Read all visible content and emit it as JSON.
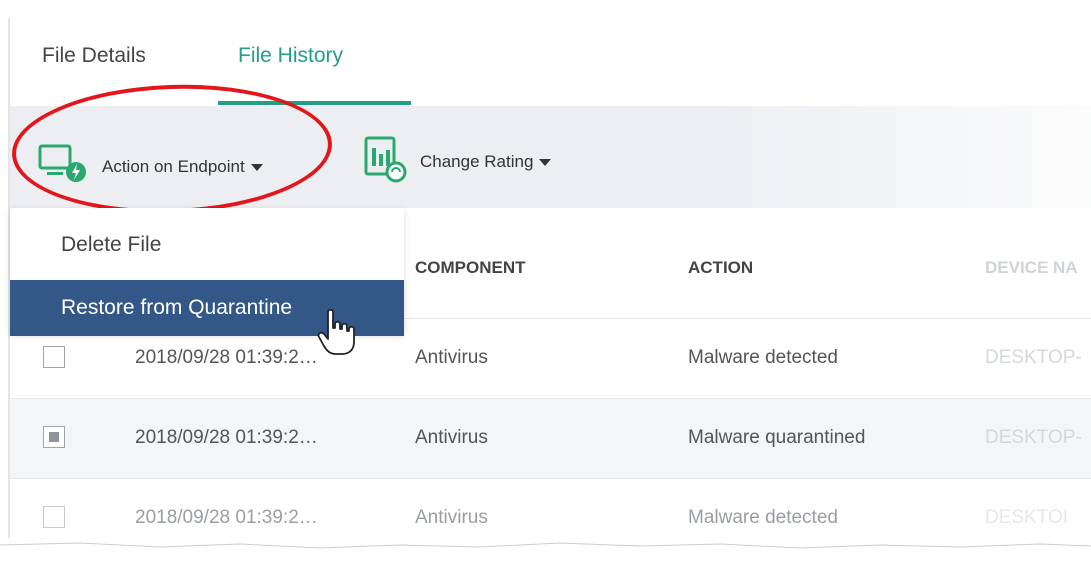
{
  "tabs": [
    {
      "label": "File Details",
      "active": false
    },
    {
      "label": "File History",
      "active": true
    }
  ],
  "toolbar": {
    "action_label": "Action on Endpoint",
    "rating_label": "Change Rating"
  },
  "dropdown": {
    "items": [
      {
        "label": "Delete File"
      },
      {
        "label": "Restore from Quarantine",
        "highlighted": true
      }
    ]
  },
  "table": {
    "columns": {
      "component": "COMPONENT",
      "action": "ACTION",
      "device": "DEVICE NA"
    },
    "rows": [
      {
        "checked": false,
        "date": "2018/09/28 01:39:2…",
        "component": "Antivirus",
        "action": "Malware detected",
        "device": "DESKTOP-"
      },
      {
        "checked": true,
        "date": "2018/09/28 01:39:2…",
        "component": "Antivirus",
        "action": "Malware quarantined",
        "device": "DESKTOP-"
      },
      {
        "checked": false,
        "date": "2018/09/28 01:39:2…",
        "component": "Antivirus",
        "action": "Malware detected",
        "device": "DESKTOI"
      }
    ]
  },
  "colors": {
    "accent": "#219e86",
    "highlight": "#335888",
    "annotation": "#e3161b"
  },
  "icons": {
    "action": "monitor-lightning-icon",
    "rating": "rating-document-icon",
    "cursor": "hand-pointer-icon"
  }
}
